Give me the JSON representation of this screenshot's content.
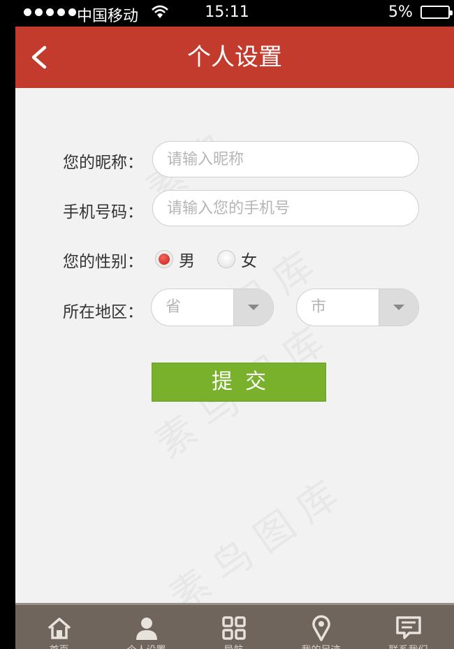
{
  "status_bar": {
    "carrier": "中国移动",
    "time": "15:11",
    "battery": "5%"
  },
  "nav": {
    "title": "个人设置"
  },
  "form": {
    "nickname_label": "您的昵称：",
    "nickname_placeholder": "请输入昵称",
    "phone_label": "手机号码：",
    "phone_placeholder": "请输入您的手机号",
    "gender_label": "您的性别：",
    "gender_options": [
      "男",
      "女"
    ],
    "region_label": "所在地区：",
    "province_placeholder": "省",
    "city_placeholder": "市",
    "submit_label": "提交"
  },
  "tab_bar": {
    "items": [
      {
        "label": "首页",
        "icon": "home-icon"
      },
      {
        "label": "个人设置",
        "icon": "user-icon"
      },
      {
        "label": "导航",
        "icon": "grid-icon"
      },
      {
        "label": "我的足迹",
        "icon": "location-icon"
      },
      {
        "label": "联系我们",
        "icon": "message-icon"
      }
    ]
  },
  "colors": {
    "header": "#c33b2d",
    "submit": "#79b02c",
    "tab_bar": "#6f655d"
  }
}
